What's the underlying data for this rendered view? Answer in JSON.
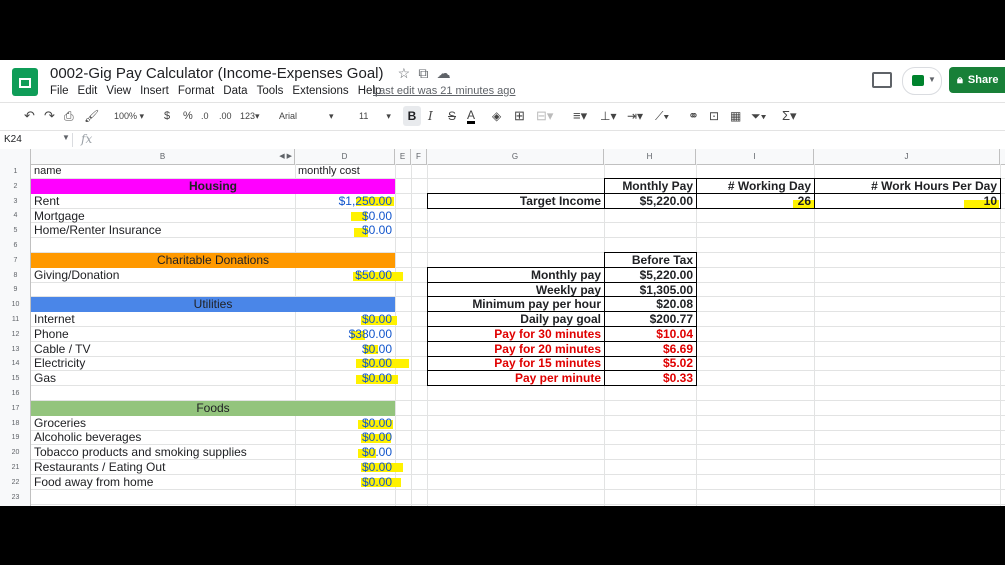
{
  "app": {
    "title": "0002-Gig Pay Calculator  (Income-Expenses Goal)",
    "menu": [
      "File",
      "Edit",
      "View",
      "Insert",
      "Format",
      "Data",
      "Tools",
      "Extensions",
      "Help"
    ],
    "last_edit": "Last edit was 21 minutes ago",
    "share_label": "Share",
    "colors": {
      "share": "#188038",
      "sheets": "#0f9d58",
      "highlight": "#fff200"
    }
  },
  "toolbar": {
    "zoom": "100%",
    "currency": "$",
    "percent": "%",
    "dec_less": ".0",
    "dec_more": ".00",
    "more_formats": "123",
    "font": "Arial",
    "font_size": "11",
    "bold": "B",
    "italic": "I",
    "strike": "S",
    "text_color": "A",
    "sigma": "Σ"
  },
  "formula_bar": {
    "cell_ref": "K24",
    "fx": "fx",
    "value": ""
  },
  "columns": [
    "B",
    "D",
    "E",
    "F",
    "G",
    "H",
    "I",
    "J"
  ],
  "rows": [
    "1",
    "2",
    "3",
    "4",
    "5",
    "6",
    "7",
    "8",
    "9",
    "10",
    "11",
    "12",
    "13",
    "14",
    "15",
    "16",
    "17",
    "18",
    "19",
    "20",
    "21",
    "22",
    "23"
  ],
  "sheet": {
    "header_name": "name",
    "header_cost": "monthly cost",
    "sections": {
      "housing": {
        "title": "Housing",
        "color": "#ff00ff"
      },
      "charity": {
        "title": "Charitable Donations",
        "color": "#ff9900"
      },
      "utilities": {
        "title": "Utilities",
        "color": "#4a86e8"
      },
      "foods": {
        "title": "Foods",
        "color": "#93c47d"
      }
    },
    "expenses": [
      {
        "name": "Rent",
        "cost": "$1,250.00"
      },
      {
        "name": "Mortgage",
        "cost": "$0.00"
      },
      {
        "name": "Home/Renter Insurance",
        "cost": "$0.00"
      },
      {
        "name": "Giving/Donation",
        "cost": "$50.00"
      },
      {
        "name": "Internet",
        "cost": "$0.00"
      },
      {
        "name": "Phone",
        "cost": "$380.00"
      },
      {
        "name": "Cable / TV",
        "cost": "$0.00"
      },
      {
        "name": "Electricity",
        "cost": "$0.00"
      },
      {
        "name": "Gas",
        "cost": "$0.00"
      },
      {
        "name": "Groceries",
        "cost": "$0.00"
      },
      {
        "name": "Alcoholic beverages",
        "cost": "$0.00"
      },
      {
        "name": "Tobacco products and smoking supplies",
        "cost": "$0.00"
      },
      {
        "name": "Restaurants / Eating Out",
        "cost": "$0.00"
      },
      {
        "name": "Food away from home",
        "cost": "$0.00"
      }
    ],
    "income": {
      "h_monthly_pay": "Monthly Pay",
      "h_working_day": "# Working Day",
      "h_work_hours": "# Work Hours Per Day",
      "target_label": "Target Income",
      "target_value": "$5,220.00",
      "working_days": "26",
      "work_hours": "10"
    },
    "before_tax": {
      "title": "Before Tax",
      "rows": [
        {
          "label": "Monthly pay",
          "value": "$5,220.00"
        },
        {
          "label": "Weekly pay",
          "value": "$1,305.00"
        },
        {
          "label": "Minimum pay per hour",
          "value": "$20.08"
        },
        {
          "label": "Daily pay goal",
          "value": "$200.77"
        },
        {
          "label": "Pay for 30 minutes",
          "value": "$10.04"
        },
        {
          "label": "Pay for 20 minutes",
          "value": "$6.69"
        },
        {
          "label": "Pay for 15 minutes",
          "value": "$5.02"
        },
        {
          "label": "Pay per minute",
          "value": "$0.33"
        }
      ]
    }
  }
}
